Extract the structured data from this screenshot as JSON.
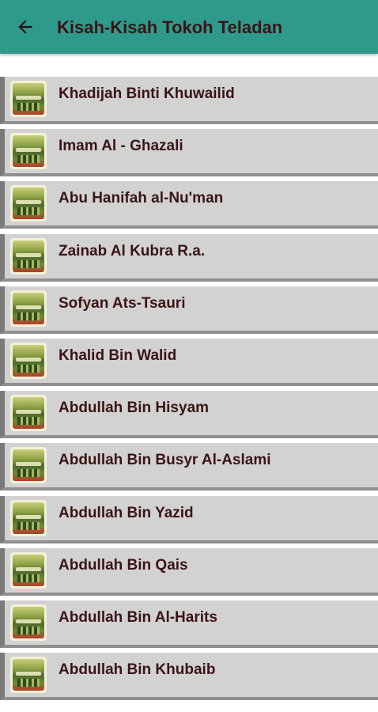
{
  "app_bar": {
    "title": "Kisah-Kisah Tokoh Teladan",
    "back_icon": "arrow-left-icon",
    "color": "#2e9a8c"
  },
  "list": {
    "items": [
      {
        "label": "Khadijah Binti Khuwailid"
      },
      {
        "label": "Imam Al - Ghazali"
      },
      {
        "label": "Abu Hanifah al-Nu'man"
      },
      {
        "label": "Zainab Al Kubra R.a."
      },
      {
        "label": "Sofyan Ats-Tsauri"
      },
      {
        "label": "Khalid Bin Walid"
      },
      {
        "label": "Abdullah Bin Hisyam"
      },
      {
        "label": "Abdullah Bin Busyr Al-Aslami"
      },
      {
        "label": "Abdullah Bin Yazid"
      },
      {
        "label": "Abdullah Bin Qais"
      },
      {
        "label": "Abdullah Bin Al-Harits"
      },
      {
        "label": "Abdullah Bin Khubaib"
      }
    ],
    "item_background": "#d2d2d2",
    "text_color": "#3a1414"
  }
}
